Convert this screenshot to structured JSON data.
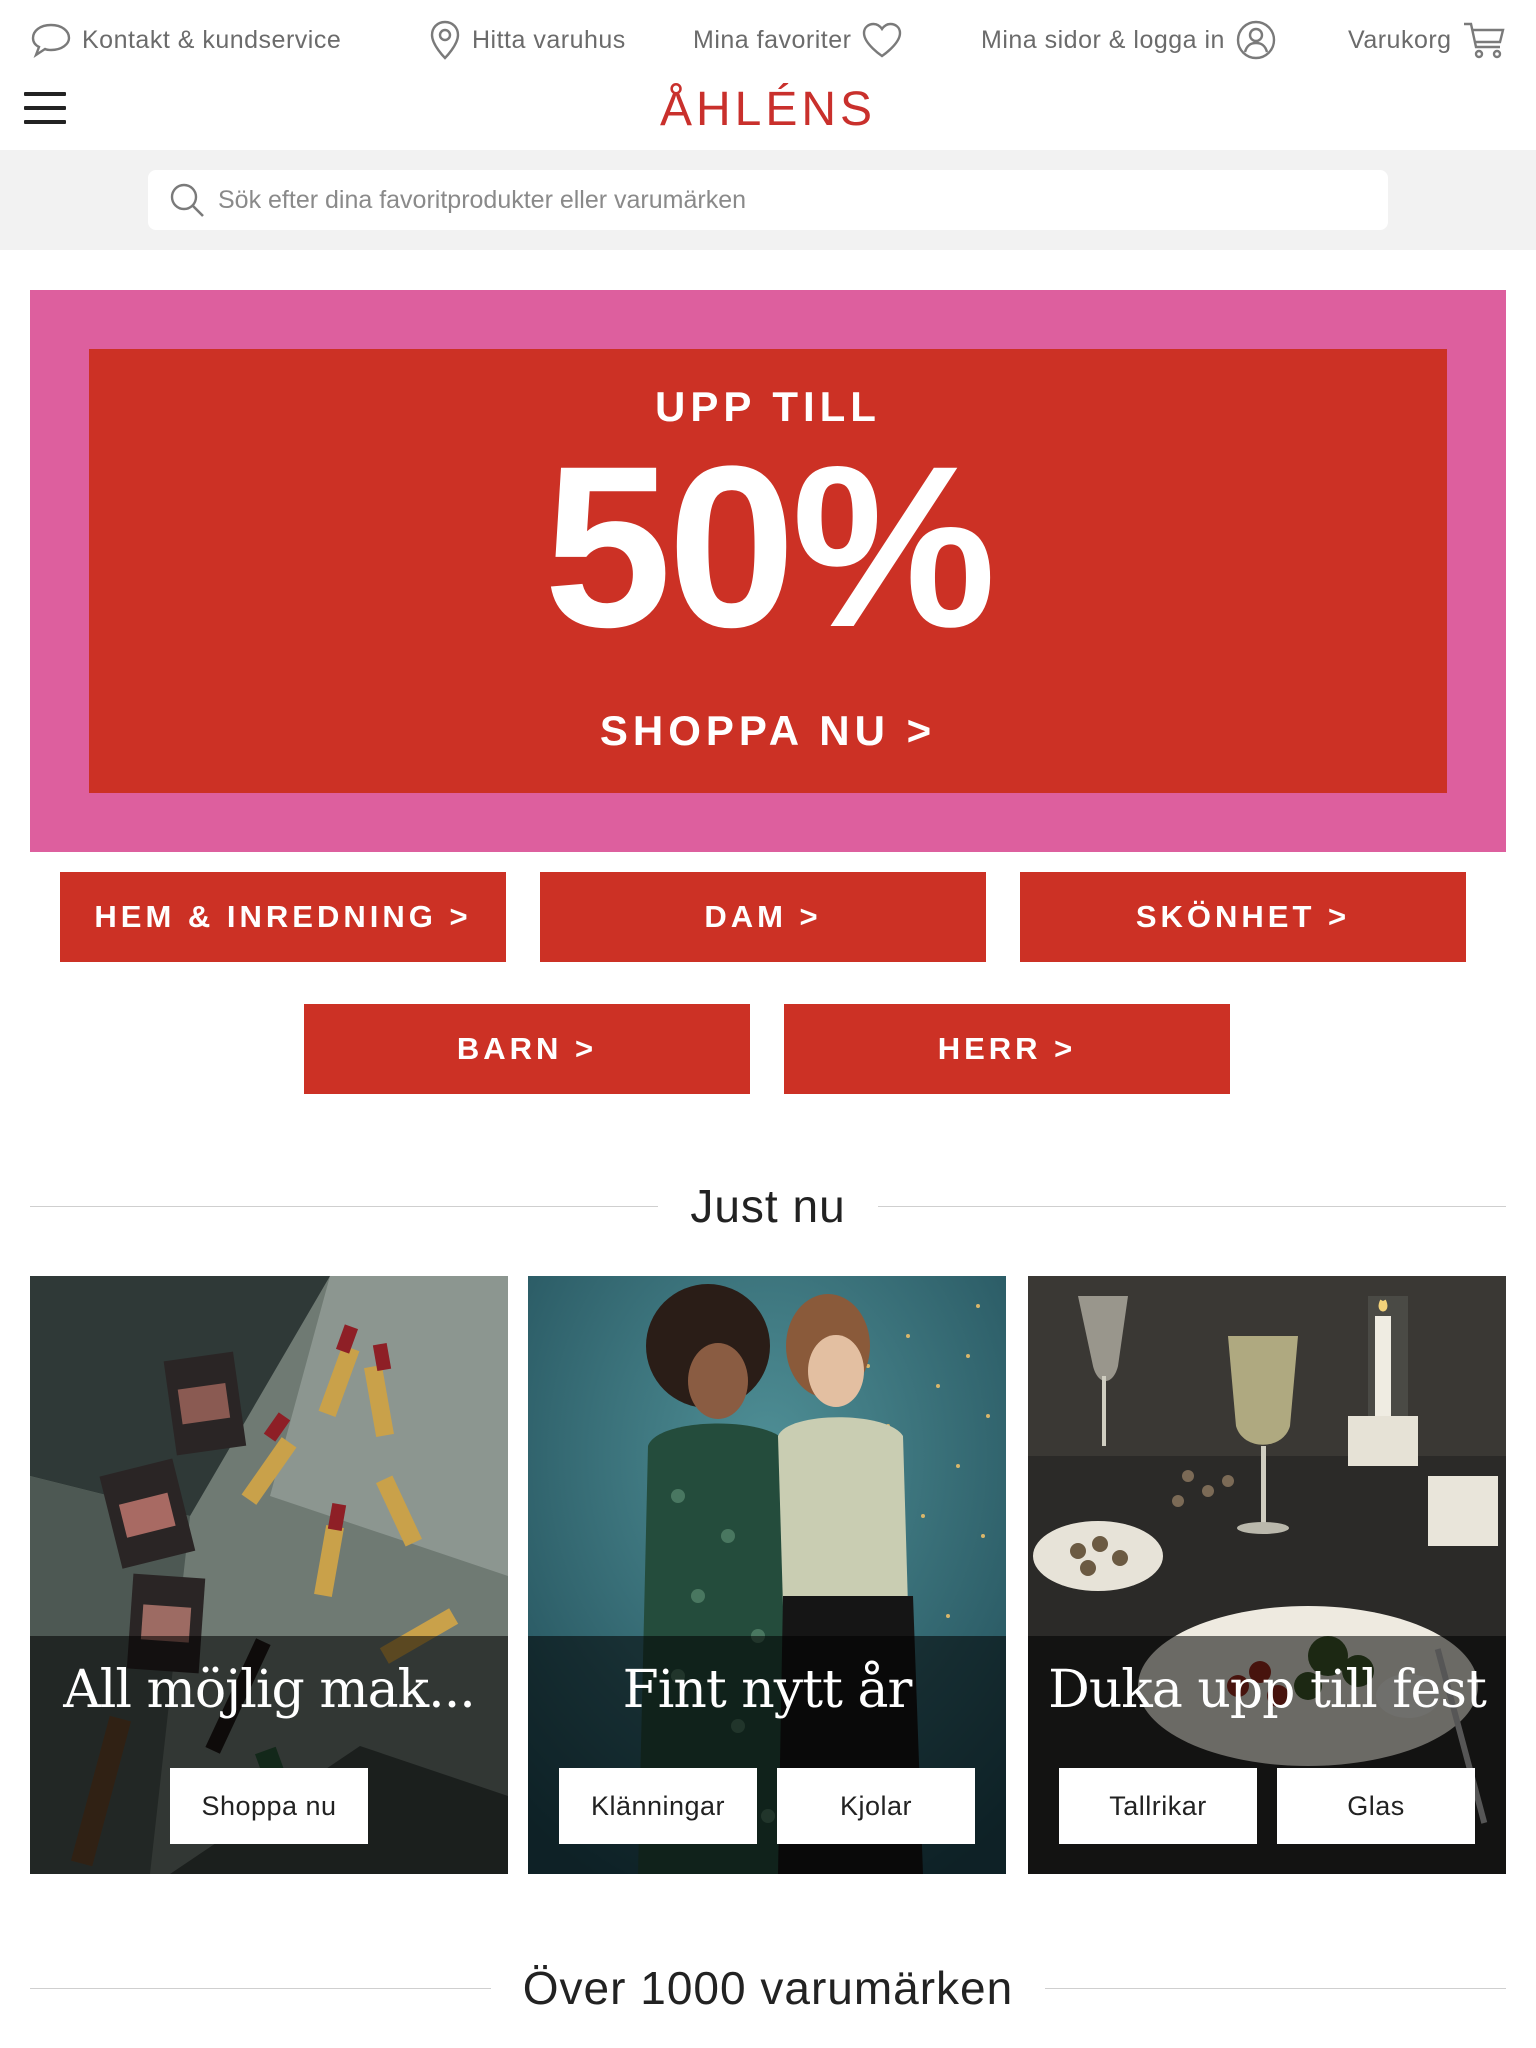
{
  "topbar": {
    "contact": "Kontakt & kundservice",
    "stores": "Hitta varuhus",
    "favorites": "Mina favoriter",
    "account": "Mina sidor & logga in",
    "cart": "Varukorg"
  },
  "logo": "ÅHLÉNS",
  "search": {
    "placeholder": "Sök efter dina favoritprodukter eller varumärken"
  },
  "hero": {
    "kicker": "UPP TILL",
    "headline": "50%",
    "cta": "SHOPPA NU  >",
    "colors": {
      "frame": "#dd5f9e",
      "panel": "#cc3125"
    }
  },
  "categories": [
    "HEM & INREDNING >",
    "DAM >",
    "SKÖNHET >",
    "BARN >",
    "HERR >"
  ],
  "just_now": {
    "heading": "Just nu",
    "tiles": [
      {
        "title": "All möjlig mak...",
        "buttons": [
          "Shoppa nu"
        ]
      },
      {
        "title": "Fint nytt år",
        "buttons": [
          "Klänningar",
          "Kjolar"
        ]
      },
      {
        "title": "Duka upp till fest",
        "buttons": [
          "Tallrikar",
          "Glas"
        ]
      }
    ]
  },
  "brands": {
    "heading": "Över 1000 varumärken"
  },
  "accent_color": "#cc3125"
}
